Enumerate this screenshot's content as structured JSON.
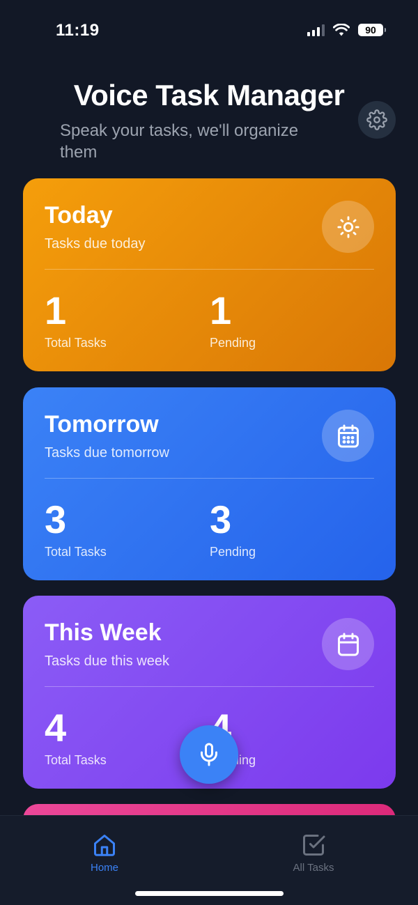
{
  "status_bar": {
    "time": "11:19",
    "battery": "90"
  },
  "header": {
    "title": "Voice Task Manager",
    "subtitle": "Speak your tasks, we'll organize them",
    "settings_icon": "gear-icon"
  },
  "cards": [
    {
      "title": "Today",
      "subtitle": "Tasks due today",
      "icon": "sun-icon",
      "total": "1",
      "total_label": "Total Tasks",
      "pending": "1",
      "pending_label": "Pending",
      "color": "#f59e0b"
    },
    {
      "title": "Tomorrow",
      "subtitle": "Tasks due tomorrow",
      "icon": "calendar-grid-icon",
      "total": "3",
      "total_label": "Total Tasks",
      "pending": "3",
      "pending_label": "Pending",
      "color": "#3b82f6"
    },
    {
      "title": "This Week",
      "subtitle": "Tasks due this week",
      "icon": "calendar-icon",
      "total": "4",
      "total_label": "Total Tasks",
      "pending": "4",
      "pending_label": "Pending",
      "color": "#8b5cf6"
    }
  ],
  "mic_button": {
    "icon": "microphone-icon",
    "color": "#3b82f6"
  },
  "bottom_nav": {
    "items": [
      {
        "label": "Home",
        "icon": "home-icon",
        "active": true
      },
      {
        "label": "All Tasks",
        "icon": "checkbox-icon",
        "active": false
      }
    ]
  }
}
